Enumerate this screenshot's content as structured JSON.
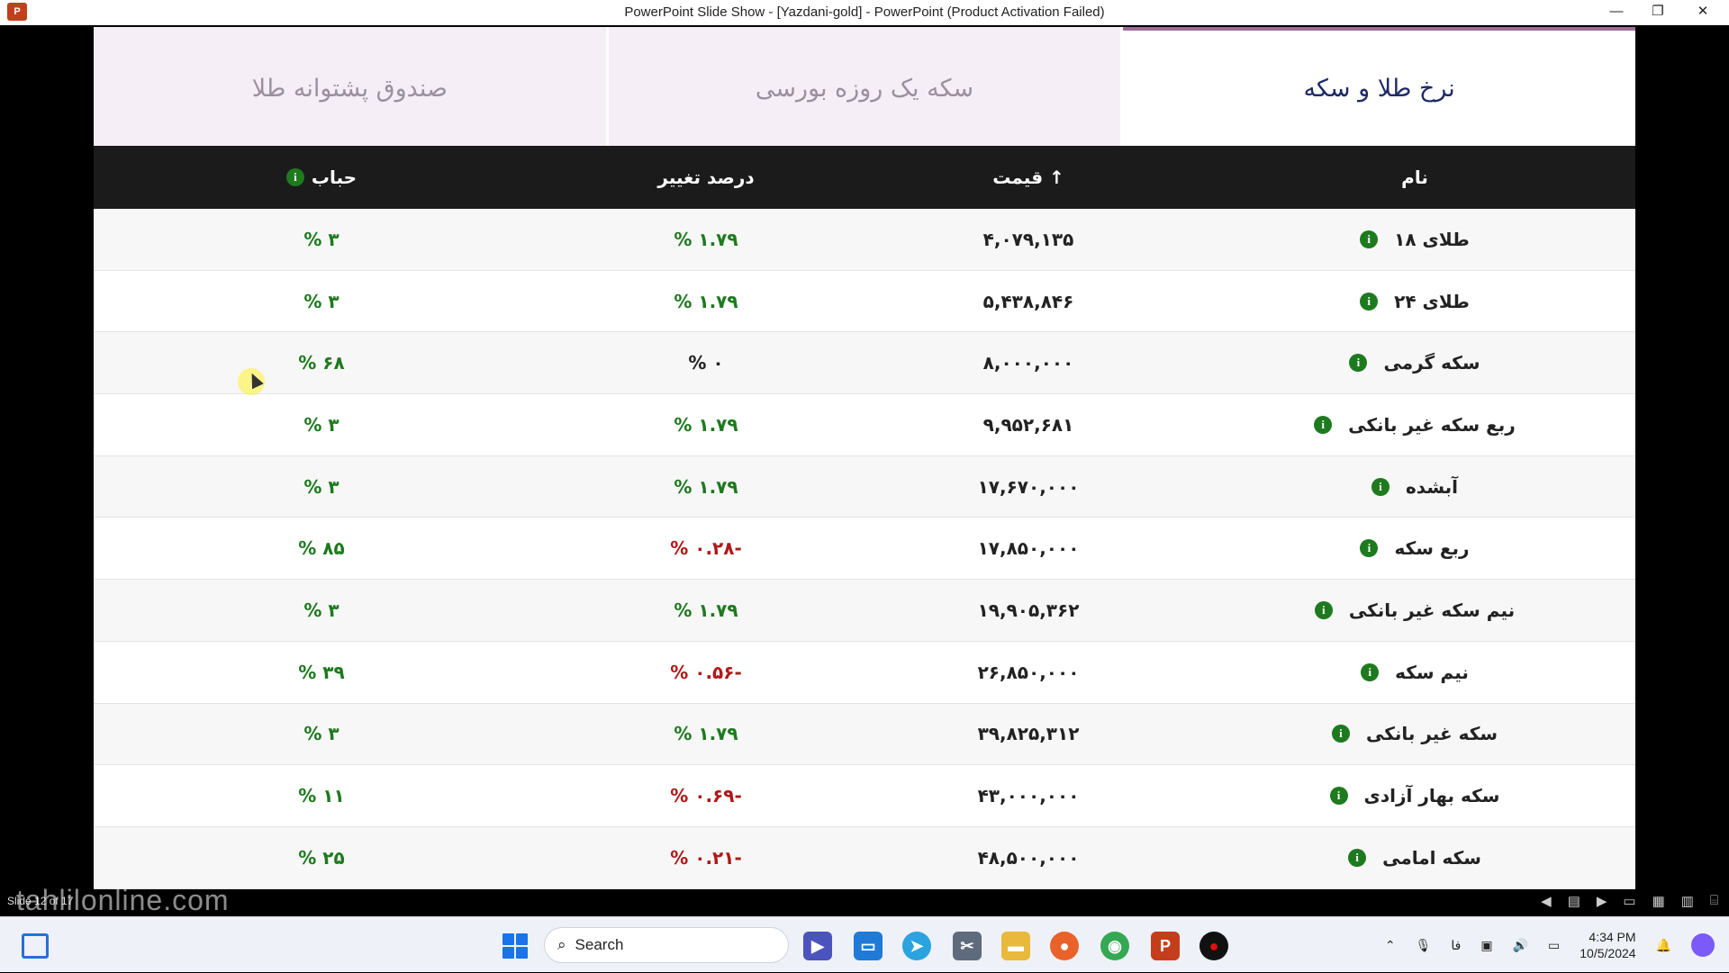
{
  "window": {
    "title": "PowerPoint Slide Show - [Yazdani-gold] - PowerPoint (Product Activation Failed)",
    "minimize": "—",
    "restore": "❐",
    "close": "✕"
  },
  "tabs": [
    {
      "label": "نرخ طلا و سکه",
      "active": true
    },
    {
      "label": "سکه یک روزه بورسی",
      "active": false
    },
    {
      "label": "صندوق پشتوانه طلا",
      "active": false
    }
  ],
  "table": {
    "headers": {
      "name": "نام",
      "price": "قیمت ↑",
      "change": "درصد تغییر",
      "bubble": "حباب"
    },
    "info_glyph": "i",
    "rows": [
      {
        "name": "طلای ۱۸",
        "price": "۴,۰۷۹,۱۳۵",
        "change": "% ۱.۷۹",
        "change_status": "positive",
        "bubble": "% ۳"
      },
      {
        "name": "طلای ۲۴",
        "price": "۵,۴۳۸,۸۴۶",
        "change": "% ۱.۷۹",
        "change_status": "positive",
        "bubble": "% ۳"
      },
      {
        "name": "سکه گرمی",
        "price": "۸,۰۰۰,۰۰۰",
        "change": "% ۰",
        "change_status": "neutral",
        "bubble": "% ۶۸"
      },
      {
        "name": "ربع سکه غیر بانکی",
        "price": "۹,۹۵۲,۶۸۱",
        "change": "% ۱.۷۹",
        "change_status": "positive",
        "bubble": "% ۳"
      },
      {
        "name": "آبشده",
        "price": "۱۷,۶۷۰,۰۰۰",
        "change": "% ۱.۷۹",
        "change_status": "positive",
        "bubble": "% ۳"
      },
      {
        "name": "ربع سکه",
        "price": "۱۷,۸۵۰,۰۰۰",
        "change": "% ۰.۲۸-",
        "change_status": "negative",
        "bubble": "% ۸۵"
      },
      {
        "name": "نیم سکه غیر بانکی",
        "price": "۱۹,۹۰۵,۳۶۲",
        "change": "% ۱.۷۹",
        "change_status": "positive",
        "bubble": "% ۳"
      },
      {
        "name": "نیم سکه",
        "price": "۲۶,۸۵۰,۰۰۰",
        "change": "% ۰.۵۶-",
        "change_status": "negative",
        "bubble": "% ۳۹"
      },
      {
        "name": "سکه غیر بانکی",
        "price": "۳۹,۸۲۵,۳۱۲",
        "change": "% ۱.۷۹",
        "change_status": "positive",
        "bubble": "% ۳"
      },
      {
        "name": "سکه بهار آزادی",
        "price": "۴۳,۰۰۰,۰۰۰",
        "change": "% ۰.۶۹-",
        "change_status": "negative",
        "bubble": "% ۱۱"
      },
      {
        "name": "سکه امامی",
        "price": "۴۸,۵۰۰,۰۰۰",
        "change": "% ۰.۲۱-",
        "change_status": "negative",
        "bubble": "% ۲۵"
      }
    ]
  },
  "statusbar": {
    "slide_count": "Slide 12 of 17"
  },
  "watermark": "tahlilonline.com",
  "taskbar": {
    "search_label": "Search",
    "language": "فا",
    "time": "4:34 PM",
    "date": "10/5/2024"
  },
  "colors": {
    "positive": "#1e7a1e",
    "negative": "#b01818",
    "header_bg": "#1b1b1b",
    "tab_active_border": "#9c6e96"
  }
}
